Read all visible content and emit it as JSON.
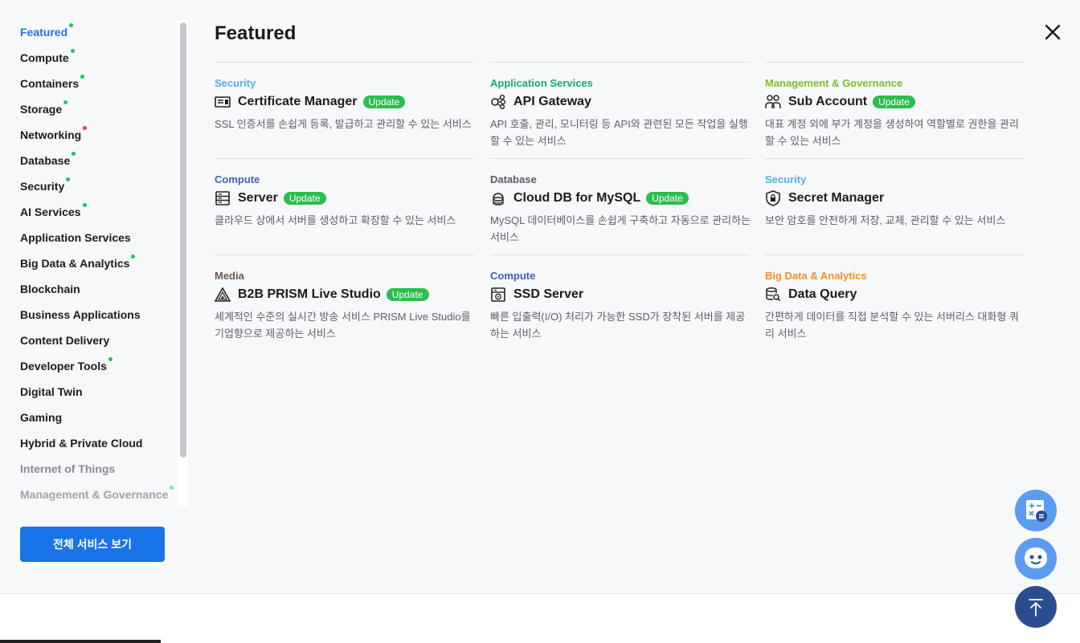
{
  "sidebar": {
    "items": [
      {
        "label": "Featured",
        "dot": "green",
        "state": "active"
      },
      {
        "label": "Compute",
        "dot": "green",
        "state": ""
      },
      {
        "label": "Containers",
        "dot": "green",
        "state": ""
      },
      {
        "label": "Storage",
        "dot": "green",
        "state": ""
      },
      {
        "label": "Networking",
        "dot": "red",
        "state": ""
      },
      {
        "label": "Database",
        "dot": "green",
        "state": ""
      },
      {
        "label": "Security",
        "dot": "green",
        "state": ""
      },
      {
        "label": "AI Services",
        "dot": "green",
        "state": ""
      },
      {
        "label": "Application Services",
        "dot": "",
        "state": ""
      },
      {
        "label": "Big Data & Analytics",
        "dot": "green",
        "state": ""
      },
      {
        "label": "Blockchain",
        "dot": "",
        "state": ""
      },
      {
        "label": "Business Applications",
        "dot": "",
        "state": ""
      },
      {
        "label": "Content Delivery",
        "dot": "",
        "state": ""
      },
      {
        "label": "Developer Tools",
        "dot": "green",
        "state": ""
      },
      {
        "label": "Digital Twin",
        "dot": "",
        "state": ""
      },
      {
        "label": "Gaming",
        "dot": "",
        "state": ""
      },
      {
        "label": "Hybrid & Private Cloud",
        "dot": "",
        "state": ""
      },
      {
        "label": "Internet of Things",
        "dot": "",
        "state": "faded"
      },
      {
        "label": "Management & Governance",
        "dot": "green",
        "state": "faded2"
      }
    ],
    "all_services_button": "전체 서비스 보기"
  },
  "main": {
    "title": "Featured",
    "cards": [
      {
        "category": "Security",
        "category_color": "#5aaee0",
        "name": "Certificate Manager",
        "badge": "Update",
        "icon": "certificate-icon",
        "desc": "SSL 인증서를 손쉽게 등록, 발급하고 관리할 수 있는 서비스"
      },
      {
        "category": "Application Services",
        "category_color": "#1aa874",
        "name": "API Gateway",
        "badge": "",
        "icon": "api-gateway-icon",
        "desc": "API 호출, 관리, 모니터링 등 API와 관련된 모든 작업을 실행할 수 있는 서비스"
      },
      {
        "category": "Management & Governance",
        "category_color": "#7cbf2a",
        "name": "Sub Account",
        "badge": "Update",
        "icon": "users-icon",
        "desc": "대표 계정 외에 부가 계정을 생성하여 역할별로 권한을 관리할 수 있는 서비스"
      },
      {
        "category": "Compute",
        "category_color": "#3d5fb8",
        "name": "Server",
        "badge": "Update",
        "icon": "server-icon",
        "desc": "클라우드 상에서 서버를 생성하고 확장할 수 있는 서비스"
      },
      {
        "category": "Database",
        "category_color": "#555a61",
        "name": "Cloud DB for MySQL",
        "badge": "Update",
        "icon": "cloud-db-icon",
        "desc": "MySQL 데이터베이스를 손쉽게 구축하고 자동으로 관리하는 서비스"
      },
      {
        "category": "Security",
        "category_color": "#5aaee0",
        "name": "Secret Manager",
        "badge": "",
        "icon": "shield-lock-icon",
        "desc": "보안 암호를 안전하게 저장, 교체, 관리할 수 있는 서비스"
      },
      {
        "category": "Media",
        "category_color": "#6b5a4a",
        "name": "B2B PRISM Live Studio",
        "badge": "Update",
        "icon": "prism-icon",
        "desc": "세계적인 수준의 실시간 방송 서비스 PRISM Live Studio를 기업향으로 제공하는 서비스"
      },
      {
        "category": "Compute",
        "category_color": "#3d5fb8",
        "name": "SSD Server",
        "badge": "",
        "icon": "ssd-server-icon",
        "desc": "빠른 입출력(I/O) 처리가 가능한 SSD가 장착된 서버를 제공하는 서비스"
      },
      {
        "category": "Big Data & Analytics",
        "category_color": "#f0902a",
        "name": "Data Query",
        "badge": "",
        "icon": "data-query-icon",
        "desc": "간편하게 데이터를 직접 분석할 수 있는 서버리스 대화형 쿼리 서비스"
      }
    ]
  },
  "floating": {
    "calculator_icon": "calculator-icon",
    "chat_icon": "chatbot-icon",
    "top_icon": "arrow-up-icon"
  }
}
